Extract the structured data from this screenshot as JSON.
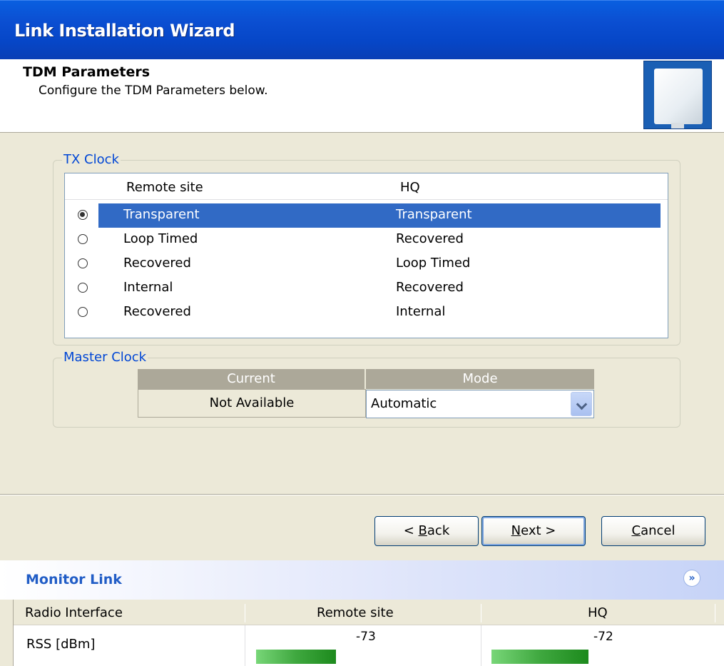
{
  "window": {
    "title": "Link Installation Wizard"
  },
  "header": {
    "title": "TDM Parameters",
    "subtitle": "Configure the TDM Parameters below.",
    "logo_icon": "antenna-panel-icon"
  },
  "tx_clock": {
    "legend": "TX Clock",
    "columns": [
      "Remote site",
      "HQ"
    ],
    "rows": [
      {
        "remote": "Transparent",
        "hq": "Transparent",
        "selected": true
      },
      {
        "remote": "Loop Timed",
        "hq": "Recovered",
        "selected": false
      },
      {
        "remote": "Recovered",
        "hq": "Loop Timed",
        "selected": false
      },
      {
        "remote": "Internal",
        "hq": "Recovered",
        "selected": false
      },
      {
        "remote": "Recovered",
        "hq": "Internal",
        "selected": false
      }
    ],
    "selection_color": "#316ac5"
  },
  "master_clock": {
    "legend": "Master Clock",
    "col_current": "Current",
    "col_mode": "Mode",
    "current_value": "Not Available",
    "mode_value": "Automatic"
  },
  "buttons": {
    "back_prefix": "< ",
    "back_mnemonic": "B",
    "back_rest": "ack",
    "next_mnemonic": "N",
    "next_rest": "ext >",
    "cancel_mnemonic": "C",
    "cancel_rest": "ancel"
  },
  "monitor": {
    "title": "Monitor Link",
    "collapse_icon": "chevron-double-up-icon",
    "columns": [
      "Radio Interface",
      "Remote site",
      "HQ"
    ],
    "row_label": "RSS [dBm]",
    "remote_value": "-73",
    "hq_value": "-72",
    "bar_color": "#3fa83f"
  }
}
